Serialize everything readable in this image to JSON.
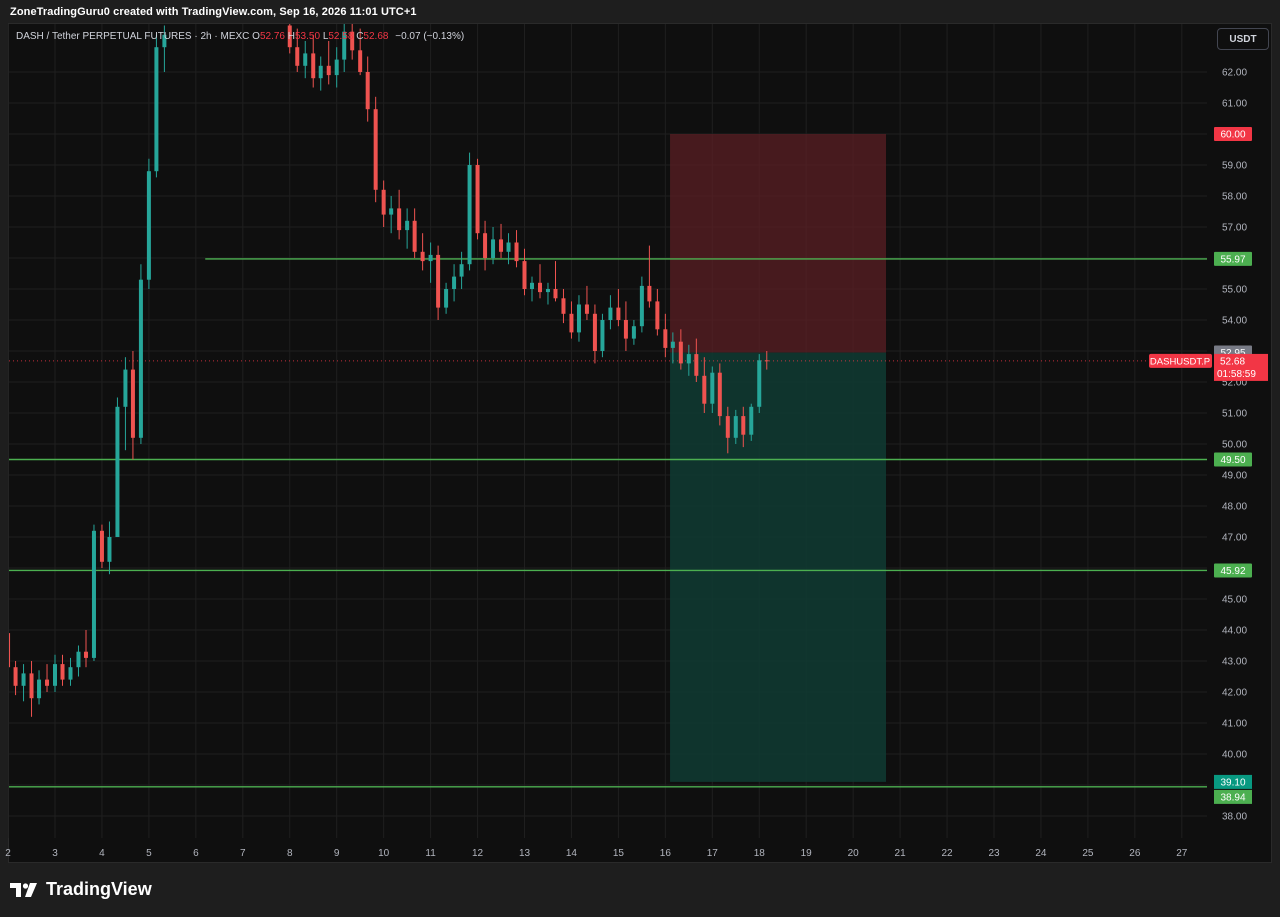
{
  "header": {
    "attribution": "ZoneTradingGuru0 created with TradingView.com, Sep 16, 2026 11:01 UTC+1"
  },
  "legend": {
    "symbol": "DASH / Tether PERPETUAL FUTURES · 2h · MEXC",
    "o_label": "O",
    "o_value": "52.76",
    "h_label": "H",
    "h_value": "53.50",
    "l_label": "L",
    "l_value": "52.58",
    "c_label": "C",
    "c_value": "52.68",
    "change": "−0.07 (−0.13%)"
  },
  "toolbar": {
    "currency_label": "USDT"
  },
  "footer": {
    "brand": "TradingView"
  },
  "colors": {
    "up": "#26a69a",
    "down": "#ef5350",
    "hline": "#4caf50",
    "stop_zone": "#5b1f24",
    "target_zone": "#0f3b32",
    "label_red": "#f23645",
    "label_green": "#4caf50"
  },
  "chart_data": {
    "type": "candlestick",
    "ylim": [
      37.5,
      63.0
    ],
    "xlim": [
      2,
      28
    ],
    "y_ticks": [
      "38.00",
      "39.00",
      "40.00",
      "41.00",
      "42.00",
      "43.00",
      "44.00",
      "45.00",
      "46.00",
      "47.00",
      "48.00",
      "49.00",
      "50.00",
      "51.00",
      "52.00",
      "53.00",
      "54.00",
      "55.00",
      "56.00",
      "57.00",
      "58.00",
      "59.00",
      "60.00",
      "61.00",
      "62.00"
    ],
    "x_ticks": [
      "2",
      "3",
      "4",
      "5",
      "6",
      "7",
      "8",
      "9",
      "10",
      "11",
      "12",
      "13",
      "14",
      "15",
      "16",
      "17",
      "18",
      "19",
      "20",
      "21",
      "22",
      "23",
      "24",
      "25",
      "26",
      "27"
    ],
    "candles": [
      [
        2.0,
        43.9,
        44.0,
        42.4,
        42.8
      ],
      [
        2.16,
        42.8,
        43.0,
        41.9,
        42.2
      ],
      [
        2.33,
        42.2,
        42.9,
        41.7,
        42.6
      ],
      [
        2.5,
        42.6,
        43.0,
        41.2,
        41.8
      ],
      [
        2.66,
        41.8,
        42.7,
        41.6,
        42.4
      ],
      [
        2.83,
        42.4,
        42.9,
        42.0,
        42.2
      ],
      [
        3.0,
        42.2,
        43.2,
        42.0,
        42.9
      ],
      [
        3.16,
        42.9,
        43.2,
        42.2,
        42.4
      ],
      [
        3.33,
        42.4,
        43.1,
        42.2,
        42.8
      ],
      [
        3.5,
        42.8,
        43.5,
        42.5,
        43.3
      ],
      [
        3.66,
        43.3,
        44.0,
        42.8,
        43.1
      ],
      [
        3.83,
        43.1,
        47.4,
        43.0,
        47.2
      ],
      [
        4.0,
        47.2,
        47.4,
        46.0,
        46.2
      ],
      [
        4.16,
        46.2,
        47.5,
        45.8,
        47.0
      ],
      [
        4.33,
        47.0,
        51.5,
        47.0,
        51.2
      ],
      [
        4.5,
        51.2,
        52.8,
        49.8,
        52.4
      ],
      [
        4.66,
        52.4,
        53.0,
        49.5,
        50.2
      ],
      [
        4.83,
        50.2,
        55.8,
        50.0,
        55.3
      ],
      [
        5.0,
        55.3,
        59.2,
        55.0,
        58.8
      ],
      [
        5.16,
        58.8,
        63.2,
        58.6,
        62.8
      ],
      [
        5.33,
        62.8,
        63.5,
        62.0,
        63.2
      ],
      [
        8.0,
        63.5,
        64.0,
        62.6,
        62.8
      ],
      [
        8.16,
        62.8,
        63.4,
        62.0,
        62.2
      ],
      [
        8.33,
        62.2,
        63.0,
        61.8,
        62.6
      ],
      [
        8.5,
        62.6,
        63.2,
        61.5,
        61.8
      ],
      [
        8.66,
        61.8,
        62.5,
        61.4,
        62.2
      ],
      [
        8.83,
        62.2,
        63.0,
        61.6,
        61.9
      ],
      [
        9.0,
        61.9,
        62.8,
        61.5,
        62.4
      ],
      [
        9.16,
        62.4,
        63.6,
        62.0,
        63.3
      ],
      [
        9.33,
        63.3,
        63.8,
        62.4,
        62.7
      ],
      [
        9.5,
        62.7,
        63.4,
        61.9,
        62.0
      ],
      [
        9.66,
        62.0,
        62.5,
        60.4,
        60.8
      ],
      [
        9.83,
        60.8,
        61.2,
        57.8,
        58.2
      ],
      [
        10.0,
        58.2,
        58.5,
        57.0,
        57.4
      ],
      [
        10.16,
        57.4,
        58.0,
        56.8,
        57.6
      ],
      [
        10.33,
        57.6,
        58.2,
        56.6,
        56.9
      ],
      [
        10.5,
        56.9,
        57.6,
        56.3,
        57.2
      ],
      [
        10.66,
        57.2,
        57.6,
        56.0,
        56.2
      ],
      [
        10.83,
        56.2,
        56.8,
        55.6,
        55.9
      ],
      [
        11.0,
        55.9,
        56.5,
        55.2,
        56.1
      ],
      [
        11.16,
        56.1,
        56.4,
        54.0,
        54.4
      ],
      [
        11.33,
        54.4,
        55.2,
        54.2,
        55.0
      ],
      [
        11.5,
        55.0,
        55.8,
        54.6,
        55.4
      ],
      [
        11.66,
        55.4,
        56.2,
        55.0,
        55.8
      ],
      [
        11.83,
        55.8,
        59.4,
        55.6,
        59.0
      ],
      [
        12.0,
        59.0,
        59.2,
        56.6,
        56.8
      ],
      [
        12.16,
        56.8,
        57.2,
        55.6,
        56.0
      ],
      [
        12.33,
        56.0,
        57.0,
        55.8,
        56.6
      ],
      [
        12.5,
        56.6,
        57.1,
        56.0,
        56.2
      ],
      [
        12.66,
        56.2,
        56.8,
        55.8,
        56.5
      ],
      [
        12.83,
        56.5,
        56.9,
        55.7,
        55.9
      ],
      [
        13.0,
        55.9,
        56.3,
        54.8,
        55.0
      ],
      [
        13.16,
        55.0,
        55.4,
        54.6,
        55.2
      ],
      [
        13.33,
        55.2,
        55.8,
        54.7,
        54.9
      ],
      [
        13.5,
        54.9,
        55.2,
        54.5,
        55.0
      ],
      [
        13.66,
        55.0,
        55.9,
        54.6,
        54.7
      ],
      [
        13.83,
        54.7,
        55.0,
        53.9,
        54.2
      ],
      [
        14.0,
        54.2,
        54.6,
        53.4,
        53.6
      ],
      [
        14.16,
        53.6,
        54.8,
        53.3,
        54.5
      ],
      [
        14.33,
        54.5,
        55.1,
        54.0,
        54.2
      ],
      [
        14.5,
        54.2,
        54.5,
        52.6,
        53.0
      ],
      [
        14.66,
        53.0,
        54.2,
        52.8,
        54.0
      ],
      [
        14.83,
        54.0,
        54.8,
        53.7,
        54.4
      ],
      [
        15.0,
        54.4,
        55.0,
        53.8,
        54.0
      ],
      [
        15.16,
        54.0,
        54.6,
        53.0,
        53.4
      ],
      [
        15.33,
        53.4,
        54.0,
        53.2,
        53.8
      ],
      [
        15.5,
        53.8,
        55.4,
        53.6,
        55.1
      ],
      [
        15.66,
        55.1,
        56.4,
        54.4,
        54.6
      ],
      [
        15.83,
        54.6,
        55.0,
        53.5,
        53.7
      ],
      [
        16.0,
        53.7,
        54.2,
        52.8,
        53.1
      ],
      [
        16.16,
        53.1,
        53.6,
        52.6,
        53.3
      ],
      [
        16.33,
        53.3,
        53.7,
        52.4,
        52.6
      ],
      [
        16.5,
        52.6,
        53.2,
        52.2,
        52.9
      ],
      [
        16.66,
        52.9,
        53.4,
        52.0,
        52.2
      ],
      [
        16.83,
        52.2,
        52.8,
        51.0,
        51.3
      ],
      [
        17.0,
        51.3,
        52.5,
        51.0,
        52.3
      ],
      [
        17.16,
        52.3,
        52.6,
        50.6,
        50.9
      ],
      [
        17.33,
        50.9,
        51.2,
        49.7,
        50.2
      ],
      [
        17.5,
        50.2,
        51.1,
        50.0,
        50.9
      ],
      [
        17.66,
        50.9,
        51.2,
        49.9,
        50.3
      ],
      [
        17.83,
        50.3,
        51.3,
        50.1,
        51.2
      ],
      [
        18.0,
        51.2,
        52.9,
        51.0,
        52.7
      ],
      [
        18.16,
        52.7,
        53.0,
        52.4,
        52.68
      ]
    ],
    "horizontal_levels": [
      {
        "value": 55.97,
        "label": "55.97",
        "x_start": 6.2
      },
      {
        "value": 49.5,
        "label": "49.50",
        "x_start": 2
      },
      {
        "value": 45.92,
        "label": "45.92",
        "x_start": 2
      },
      {
        "value": 38.94,
        "label": "38.94",
        "x_start": 2
      }
    ],
    "position": {
      "x_start": 16.1,
      "x_end": 20.7,
      "entry": 52.95,
      "stop": 60.0,
      "target": 39.1,
      "entry_label": "52.95",
      "stop_label": "60.00",
      "target_label": "39.10"
    },
    "last_price": {
      "value": 52.68,
      "label": "52.68",
      "symbol": "DASHUSDT.P",
      "countdown": "01:58:59"
    }
  }
}
